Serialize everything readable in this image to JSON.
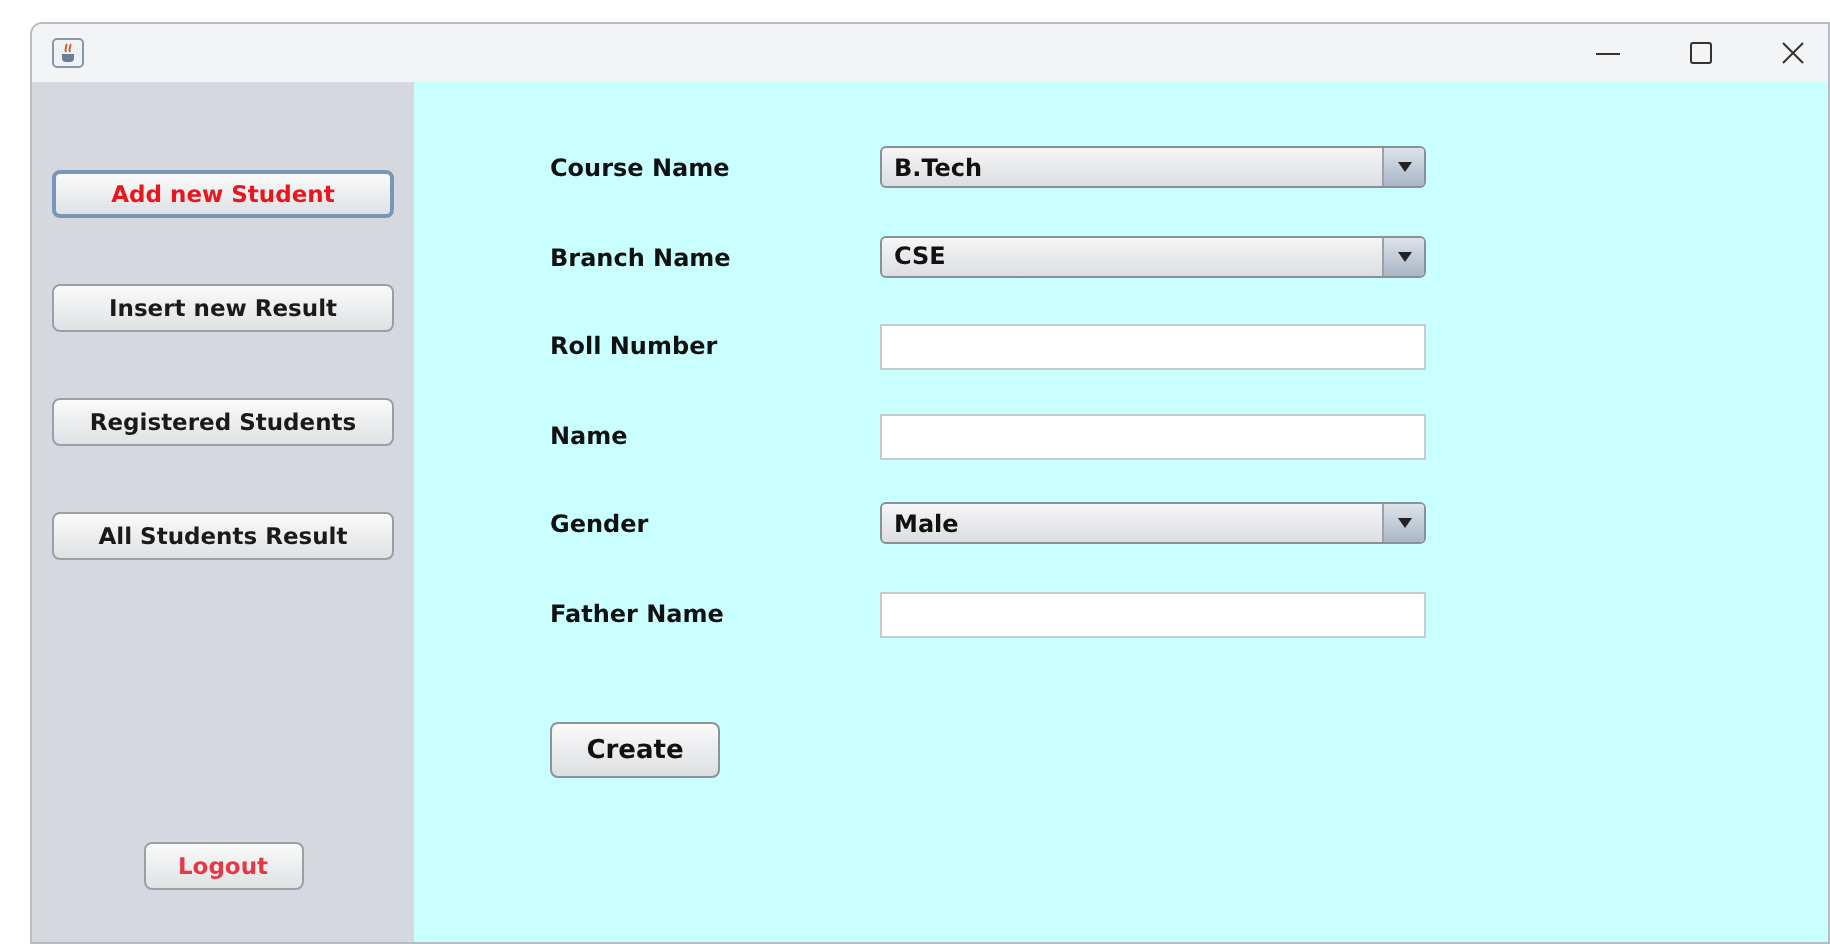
{
  "sidebar": {
    "buttons": [
      {
        "label": "Add new Student",
        "selected": true,
        "color": "#e8161e"
      },
      {
        "label": "Insert new Result",
        "selected": false,
        "color": "#1a1a1a"
      },
      {
        "label": "Registered Students",
        "selected": false,
        "color": "#1a1a1a"
      },
      {
        "label": "All Students Result",
        "selected": false,
        "color": "#1a1a1a"
      }
    ],
    "logout": {
      "label": "Logout",
      "color": "#e23a44"
    }
  },
  "form": {
    "fields": [
      {
        "label": "Course Name",
        "kind": "select",
        "value": "B.Tech"
      },
      {
        "label": "Branch Name",
        "kind": "select",
        "value": "CSE"
      },
      {
        "label": "Roll Number",
        "kind": "text"
      },
      {
        "label": "Name",
        "kind": "text"
      },
      {
        "label": "Gender",
        "kind": "select",
        "value": "Male"
      },
      {
        "label": "Father Name",
        "kind": "text"
      }
    ],
    "submit": "Create"
  }
}
